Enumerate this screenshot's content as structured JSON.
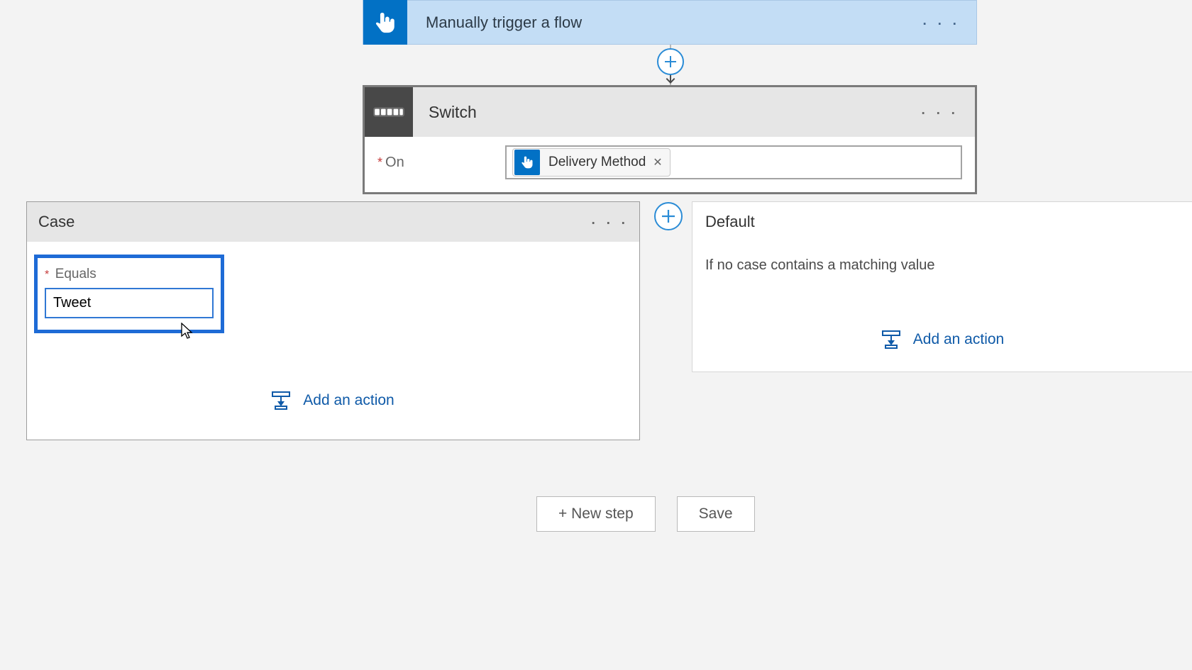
{
  "trigger": {
    "title": "Manually trigger a flow"
  },
  "switch": {
    "title": "Switch",
    "on_label": "On",
    "token": {
      "label": "Delivery Method"
    }
  },
  "case": {
    "title": "Case",
    "equals_label": "Equals",
    "equals_value": "Tweet",
    "add_action_label": "Add an action"
  },
  "default": {
    "title": "Default",
    "description": "If no case contains a matching value",
    "add_action_label": "Add an action"
  },
  "buttons": {
    "new_step": "+ New step",
    "save": "Save"
  }
}
